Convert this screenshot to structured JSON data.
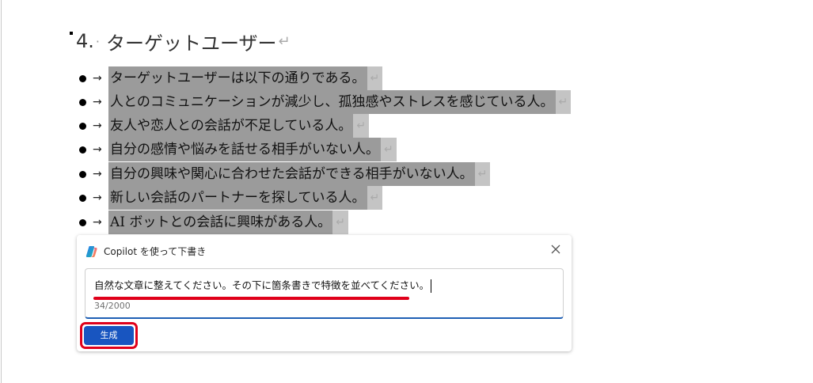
{
  "document": {
    "heading": {
      "number": "4.",
      "text": "ターゲットユーザー",
      "paragraph_mark": "↵"
    },
    "bullets": [
      {
        "arrow": "→",
        "text": "ターゲットユーザーは以下の通りである。",
        "mark": "↵"
      },
      {
        "arrow": "→",
        "text": "人とのコミュニケーションが減少し、孤独感やストレスを感じている人。",
        "mark": "↵"
      },
      {
        "arrow": "→",
        "text": "友人や恋人との会話が不足している人。",
        "mark": "↵"
      },
      {
        "arrow": "→",
        "text": "自分の感情や悩みを話せる相手がいない人。",
        "mark": "↵"
      },
      {
        "arrow": "→",
        "text": "自分の興味や関心に合わせた会話ができる相手がいない人。",
        "mark": "↵"
      },
      {
        "arrow": "→",
        "text": "新しい会話のパートナーを探している人。",
        "mark": "↵"
      },
      {
        "arrow": "→",
        "text": "AI ボットとの会話に興味がある人。",
        "mark": "↵"
      }
    ]
  },
  "copilot_dialog": {
    "title": "Copilot を使って下書き",
    "logo_icon": "copilot-logo-icon",
    "close_icon": "close-icon",
    "prompt_value": "自然な文章に整えてください。その下に箇条書きで特徴を並べてください。",
    "char_count": "34/2000",
    "generate_label": "生成"
  },
  "colors": {
    "selection": "#9b9b9b",
    "selection_mark": "#c4c4c4",
    "accent_blue": "#1855c0",
    "annotation_red": "#e0001a"
  }
}
